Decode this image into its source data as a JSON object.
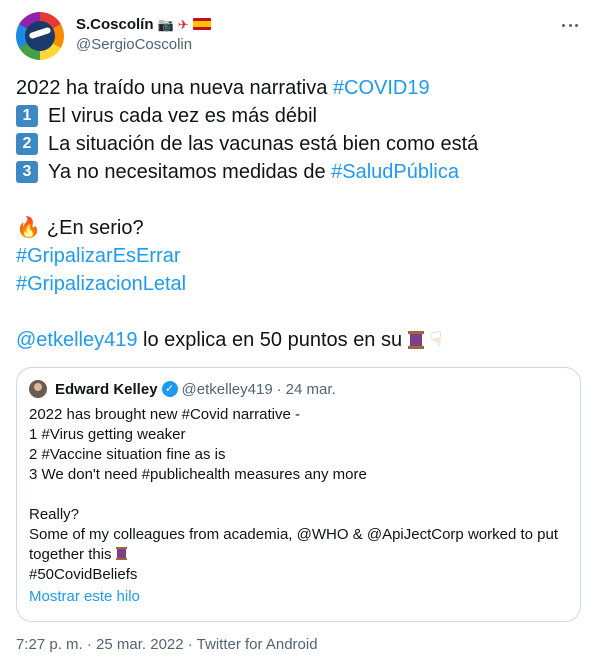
{
  "author": {
    "name": "S.Coscolín",
    "handle": "@SergioCoscolin",
    "name_emojis": [
      "camera-icon",
      "no-airplane-icon",
      "spain-flag-icon"
    ]
  },
  "tweet": {
    "line1_text": "2022 ha traído una nueva narrativa ",
    "line1_hashtag": "#COVID19",
    "item1_num": "1",
    "item1_text": "El virus cada vez es más débil",
    "item2_num": "2",
    "item2_text": "La situación de las vacunas está bien como está",
    "item3_num": "3",
    "item3_text": "Ya no necesitamos medidas de ",
    "item3_hashtag": "#SaludPública",
    "question": "¿En serio?",
    "hashtag1": "#GripalizarEsErrar",
    "hashtag2": "#GripalizacionLetal",
    "mention": "@etkelley419",
    "mention_text": " lo explica en 50 puntos en su"
  },
  "quote": {
    "name": "Edward Kelley",
    "handle": "@etkelley419",
    "separator": "·",
    "date": "24 mar.",
    "lines": [
      "2022 has brought new #Covid narrative -",
      "1 #Virus getting weaker",
      "2 #Vaccine situation fine as is",
      "3 We don't need #publichealth measures any more",
      "Really?",
      "Some of my colleagues from academia, @WHO & @ApiJectCorp worked to put",
      "together this",
      "#50CovidBeliefs"
    ],
    "show_thread": "Mostrar este hilo"
  },
  "footer": {
    "time": "7:27 p. m.",
    "separator": " · ",
    "date": "25 mar. 2022",
    "source": "Twitter for Android"
  },
  "colors": {
    "link": "#1d9bf0",
    "text": "#0f1419",
    "secondary": "#536471",
    "border": "#cfd9de"
  }
}
